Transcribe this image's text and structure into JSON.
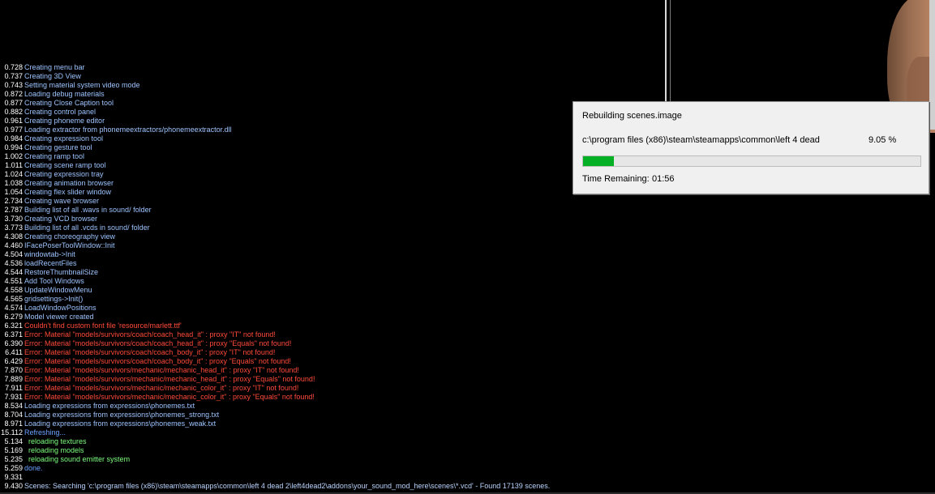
{
  "console": [
    {
      "time": "0.728",
      "msg": "Creating menu bar",
      "kind": "info"
    },
    {
      "time": "0.737",
      "msg": "Creating 3D View",
      "kind": "info"
    },
    {
      "time": "0.743",
      "msg": "Setting material system video mode",
      "kind": "info"
    },
    {
      "time": "0.872",
      "msg": "Loading debug materials",
      "kind": "info"
    },
    {
      "time": "0.877",
      "msg": "Creating Close Caption tool",
      "kind": "info"
    },
    {
      "time": "0.882",
      "msg": "Creating control panel",
      "kind": "info"
    },
    {
      "time": "0.961",
      "msg": "Creating phoneme editor",
      "kind": "info"
    },
    {
      "time": "0.977",
      "msg": "Loading extractor from phonemeextractors/phonemeextractor.dll",
      "kind": "info"
    },
    {
      "time": "0.984",
      "msg": "Creating expression tool",
      "kind": "info"
    },
    {
      "time": "0.994",
      "msg": "Creating gesture tool",
      "kind": "info"
    },
    {
      "time": "1.002",
      "msg": "Creating ramp tool",
      "kind": "info"
    },
    {
      "time": "1.011",
      "msg": "Creating scene ramp tool",
      "kind": "info"
    },
    {
      "time": "1.024",
      "msg": "Creating expression tray",
      "kind": "info"
    },
    {
      "time": "1.038",
      "msg": "Creating animation browser",
      "kind": "info"
    },
    {
      "time": "1.054",
      "msg": "Creating flex slider window",
      "kind": "info"
    },
    {
      "time": "2.734",
      "msg": "Creating wave browser",
      "kind": "info"
    },
    {
      "time": "2.787",
      "msg": "Building list of all .wavs in sound/ folder",
      "kind": "info"
    },
    {
      "time": "3.730",
      "msg": "Creating VCD browser",
      "kind": "info"
    },
    {
      "time": "3.773",
      "msg": "Building list of all .vcds in sound/ folder",
      "kind": "info"
    },
    {
      "time": "4.308",
      "msg": "Creating choreography view",
      "kind": "info"
    },
    {
      "time": "4.460",
      "msg": "IFacePoserToolWindow::Init",
      "kind": "info"
    },
    {
      "time": "4.504",
      "msg": "windowtab->Init",
      "kind": "info"
    },
    {
      "time": "4.536",
      "msg": "loadRecentFiles",
      "kind": "info"
    },
    {
      "time": "4.544",
      "msg": "RestoreThumbnailSize",
      "kind": "info"
    },
    {
      "time": "4.551",
      "msg": "Add Tool Windows",
      "kind": "info"
    },
    {
      "time": "4.558",
      "msg": "UpdateWindowMenu",
      "kind": "info"
    },
    {
      "time": "4.565",
      "msg": "gridsettings->Init()",
      "kind": "info"
    },
    {
      "time": "4.574",
      "msg": "LoadWindowPositions",
      "kind": "info"
    },
    {
      "time": "6.279",
      "msg": "Model viewer created",
      "kind": "info"
    },
    {
      "time": "6.321",
      "msg": "Couldn't find custom font file 'resource/marlett.ttf'",
      "kind": "error"
    },
    {
      "time": "6.371",
      "msg": "Error: Material \"models/survivors/coach/coach_head_it\" : proxy \"IT\" not found!",
      "kind": "error"
    },
    {
      "time": "6.390",
      "msg": "Error: Material \"models/survivors/coach/coach_head_it\" : proxy \"Equals\" not found!",
      "kind": "error"
    },
    {
      "time": "6.411",
      "msg": "Error: Material \"models/survivors/coach/coach_body_it\" : proxy \"IT\" not found!",
      "kind": "error"
    },
    {
      "time": "6.429",
      "msg": "Error: Material \"models/survivors/coach/coach_body_it\" : proxy \"Equals\" not found!",
      "kind": "error"
    },
    {
      "time": "7.870",
      "msg": "Error: Material \"models/survivors/mechanic/mechanic_head_it\" : proxy \"IT\" not found!",
      "kind": "error"
    },
    {
      "time": "7.889",
      "msg": "Error: Material \"models/survivors/mechanic/mechanic_head_it\" : proxy \"Equals\" not found!",
      "kind": "error"
    },
    {
      "time": "7.911",
      "msg": "Error: Material \"models/survivors/mechanic/mechanic_color_it\" : proxy \"IT\" not found!",
      "kind": "error"
    },
    {
      "time": "7.931",
      "msg": "Error: Material \"models/survivors/mechanic/mechanic_color_it\" : proxy \"Equals\" not found!",
      "kind": "error"
    },
    {
      "time": "8.534",
      "msg": "Loading expressions from expressions\\phonemes.txt",
      "kind": "info"
    },
    {
      "time": "8.704",
      "msg": "Loading expressions from expressions\\phonemes_strong.txt",
      "kind": "info"
    },
    {
      "time": "8.971",
      "msg": "Loading expressions from expressions\\phonemes_weak.txt",
      "kind": "info"
    },
    {
      "time": "15.112",
      "msg": "Refreshing...",
      "kind": "blue"
    },
    {
      "time": "5.134",
      "msg": "  reloading textures",
      "kind": "green"
    },
    {
      "time": "5.169",
      "msg": "  reloading models",
      "kind": "green"
    },
    {
      "time": "5.235",
      "msg": "  reloading sound emitter system",
      "kind": "green"
    },
    {
      "time": "5.259",
      "msg": "done.",
      "kind": "blue"
    },
    {
      "time": "9.331",
      "msg": "",
      "kind": "info"
    },
    {
      "time": "9.430",
      "msg": "Scenes: Searching 'c:\\program files (x86)\\steam\\steamapps\\common\\left 4 dead 2\\left4dead2\\addons\\your_sound_mod_here\\scenes\\*.vcd' - Found 17139 scenes.",
      "kind": "bluelow"
    }
  ],
  "dialog": {
    "title": "Rebuilding scenes.image",
    "path": "c:\\program files (x86)\\steam\\steamapps\\common\\left 4 dead",
    "percent_text": "9.05 %",
    "progress_fraction": 0.0905,
    "time_label": "Time Remaining:",
    "time_value": "01:56"
  },
  "colors": {
    "background": "#000000",
    "progress": "#06b025",
    "error": "#ff4a3a",
    "success": "#7dff7d"
  }
}
